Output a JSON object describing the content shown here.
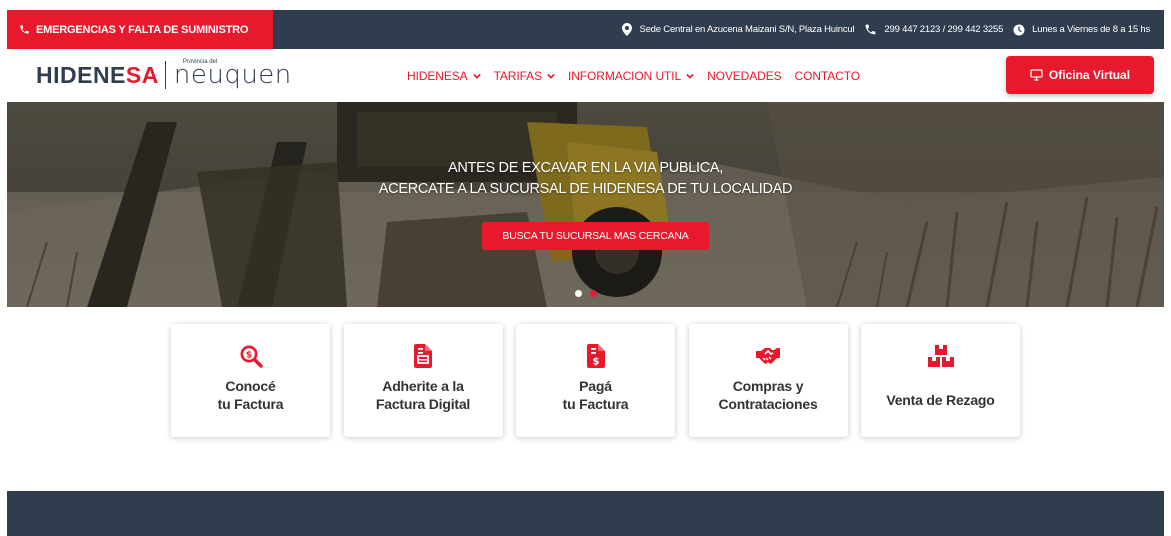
{
  "colors": {
    "brand_red": "#e8192c",
    "navy": "#2f3d4e",
    "text": "#333333"
  },
  "topbar": {
    "emergency_label": "EMERGENCIAS Y FALTA DE SUMINISTRO",
    "emergency_icon": "phone-icon",
    "address": "Sede Central en Azucena Maizani S/N, Plaza Huincul",
    "address_icon": "location-pin-icon",
    "phones": "299 447 2123 / 299 442 3255",
    "phones_icon": "phone-icon",
    "hours": "Lunes a Viernes de 8 a 15 hs",
    "hours_icon": "clock-icon"
  },
  "header": {
    "logo": {
      "part1": "HIDENE",
      "part2": "SA",
      "province_small": "Provincia del",
      "province_big": "neuquen"
    },
    "nav": [
      {
        "label": "HIDENESA",
        "dropdown": true
      },
      {
        "label": "TARIFAS",
        "dropdown": true
      },
      {
        "label": "INFORMACION UTIL",
        "dropdown": true
      },
      {
        "label": "NOVEDADES",
        "dropdown": false
      },
      {
        "label": "CONTACTO",
        "dropdown": false
      }
    ],
    "cta_label": "Oficina Virtual",
    "cta_icon": "monitor-icon"
  },
  "hero": {
    "line1": "ANTES DE EXCAVAR EN LA VIA PUBLICA,",
    "line2": "ACERCATE A LA SUCURSAL DE HIDENESA DE TU LOCALIDAD",
    "button_label": "BUSCA TU SUCURSAL MAS CERCANA",
    "slides": 2,
    "active_slide": 2
  },
  "cards": [
    {
      "line1": "Conocé",
      "line2": "tu Factura",
      "icon": "search-dollar-icon"
    },
    {
      "line1": "Adherite a la",
      "line2": "Factura Digital",
      "icon": "digital-invoice-icon"
    },
    {
      "line1": "Pagá",
      "line2": "tu Factura",
      "icon": "invoice-dollar-icon"
    },
    {
      "line1": "Compras y",
      "line2": "Contrataciones",
      "icon": "handshake-icon"
    },
    {
      "line1": "Venta de Rezago",
      "line2": "",
      "icon": "boxes-icon"
    }
  ]
}
